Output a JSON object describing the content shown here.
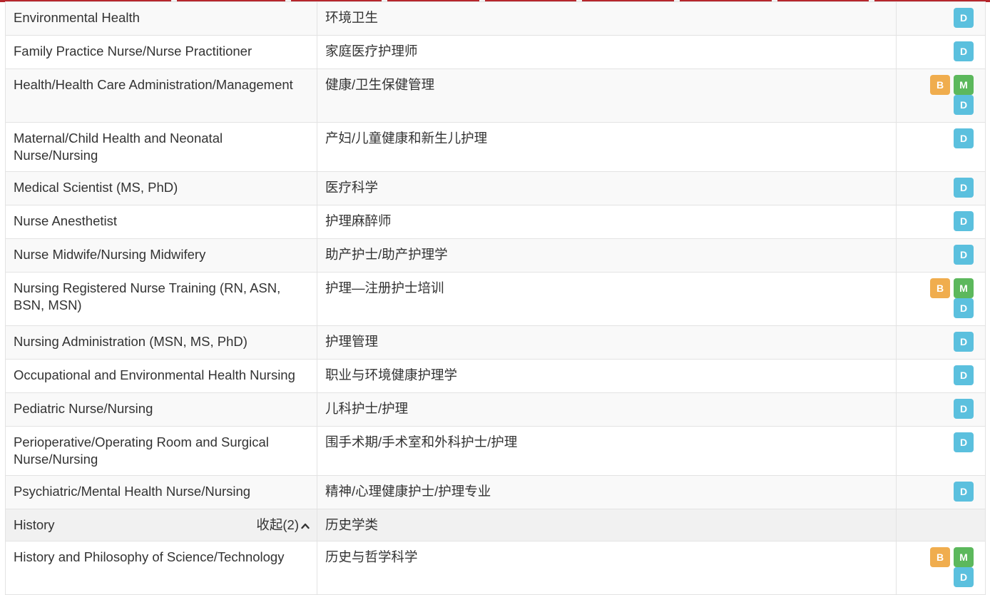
{
  "colors": {
    "badge_b": "#f0ad4e",
    "badge_m": "#5cb85c",
    "badge_d": "#5bc0de",
    "accent_bar": "#b5262c",
    "group_row_bg": "#f1f1f1"
  },
  "badge_labels": {
    "b": "B",
    "m": "M",
    "d": "D"
  },
  "rows": [
    {
      "en": "Environmental Health",
      "cn": "环境卫生"
    },
    {
      "en": "Family Practice Nurse/Nurse Practitioner",
      "cn": "家庭医疗护理师"
    },
    {
      "en": "Health/Health Care Administration/Management",
      "cn": "健康/卫生保健管理"
    },
    {
      "en": "Maternal/Child Health and Neonatal Nurse/Nursing",
      "cn": "产妇/儿童健康和新生儿护理"
    },
    {
      "en": "Medical Scientist (MS, PhD)",
      "cn": "医疗科学"
    },
    {
      "en": "Nurse Anesthetist",
      "cn": "护理麻醉师"
    },
    {
      "en": "Nurse Midwife/Nursing Midwifery",
      "cn": "助产护士/助产护理学"
    },
    {
      "en": "Nursing Registered Nurse Training (RN, ASN, BSN, MSN)",
      "cn": "护理—注册护士培训"
    },
    {
      "en": "Nursing Administration (MSN, MS, PhD)",
      "cn": "护理管理"
    },
    {
      "en": "Occupational and Environmental Health Nursing",
      "cn": "职业与环境健康护理学"
    },
    {
      "en": "Pediatric Nurse/Nursing",
      "cn": "儿科护士/护理"
    },
    {
      "en": "Perioperative/Operating Room and Surgical Nurse/Nursing",
      "cn": "围手术期/手术室和外科护士/护理"
    },
    {
      "en": "Psychiatric/Mental Health Nurse/Nursing",
      "cn": "精神/心理健康护士/护理专业"
    }
  ],
  "group": {
    "en": "History",
    "collapse_label": "收起(2)",
    "cn": "历史学类"
  },
  "group_rows": [
    {
      "en": "History and Philosophy of Science/Technology",
      "cn": "历史与哲学科学"
    }
  ]
}
